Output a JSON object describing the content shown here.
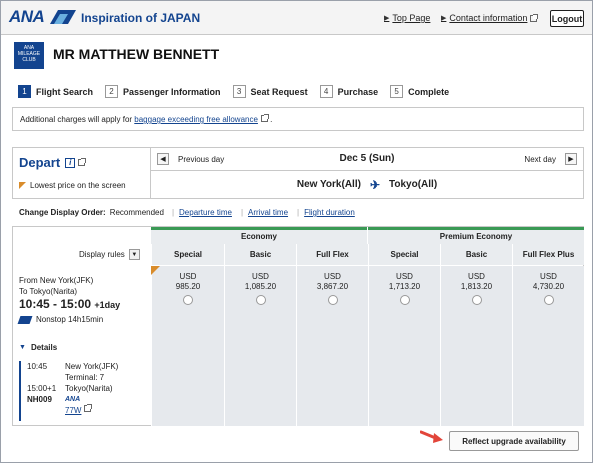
{
  "header": {
    "logo": "ANA",
    "tagline": "Inspiration of JAPAN",
    "top_page": "Top Page",
    "contact": "Contact information",
    "logout": "Logout"
  },
  "member": {
    "club_logo_text": "ANA MILEAGE CLUB",
    "name": "MR MATTHEW BENNETT"
  },
  "steps": [
    {
      "num": "1",
      "label": "Flight Search"
    },
    {
      "num": "2",
      "label": "Passenger Information"
    },
    {
      "num": "3",
      "label": "Seat Request"
    },
    {
      "num": "4",
      "label": "Purchase"
    },
    {
      "num": "5",
      "label": "Complete"
    }
  ],
  "notice": {
    "text_before": "Additional charges will apply for ",
    "link": "baggage exceeding free allowance",
    "text_after": " ."
  },
  "depart": {
    "title": "Depart",
    "info_icon": "i",
    "lowest_price": "Lowest price on the screen"
  },
  "datebar": {
    "prev": "Previous day",
    "date": "Dec 5 (Sun)",
    "next": "Next day"
  },
  "route": {
    "origin": "New York(All)",
    "destination": "Tokyo(All)"
  },
  "sort": {
    "label": "Change Display Order:",
    "current": "Recommended",
    "options": [
      "Departure time",
      "Arrival time",
      "Flight duration"
    ]
  },
  "grid": {
    "display_rules": "Display rules",
    "cabins": [
      "Economy",
      "Premium Economy"
    ],
    "fares": [
      {
        "name": "Special",
        "currency": "USD",
        "price": "985.20"
      },
      {
        "name": "Basic",
        "currency": "USD",
        "price": "1,085.20"
      },
      {
        "name": "Full Flex",
        "currency": "USD",
        "price": "3,867.20"
      },
      {
        "name": "Special",
        "currency": "USD",
        "price": "1,713.20"
      },
      {
        "name": "Basic",
        "currency": "USD",
        "price": "1,813.20"
      },
      {
        "name": "Full Flex Plus",
        "currency": "USD",
        "price": "4,730.20"
      }
    ]
  },
  "flight": {
    "from": "From  New York(JFK)",
    "to": "To Tokyo(Narita)",
    "times": "10:45 - 15:00",
    "day_offset": "+1day",
    "nonstop": "Nonstop 14h15min",
    "details": "Details",
    "dep_time": "10:45",
    "dep_city": "New York(JFK)",
    "dep_terminal": "Terminal: 7",
    "arr_time": "15:00+1",
    "arr_city": "Tokyo(Narita)",
    "flight_no": "NH009",
    "airline": "ANA",
    "aircraft": "77W"
  },
  "upgrade": {
    "label": "Reflect upgrade availability"
  },
  "colors": {
    "brand": "#13448f",
    "cabin_bar": "#3a9a55",
    "lowest_flag": "#d98c2b"
  }
}
